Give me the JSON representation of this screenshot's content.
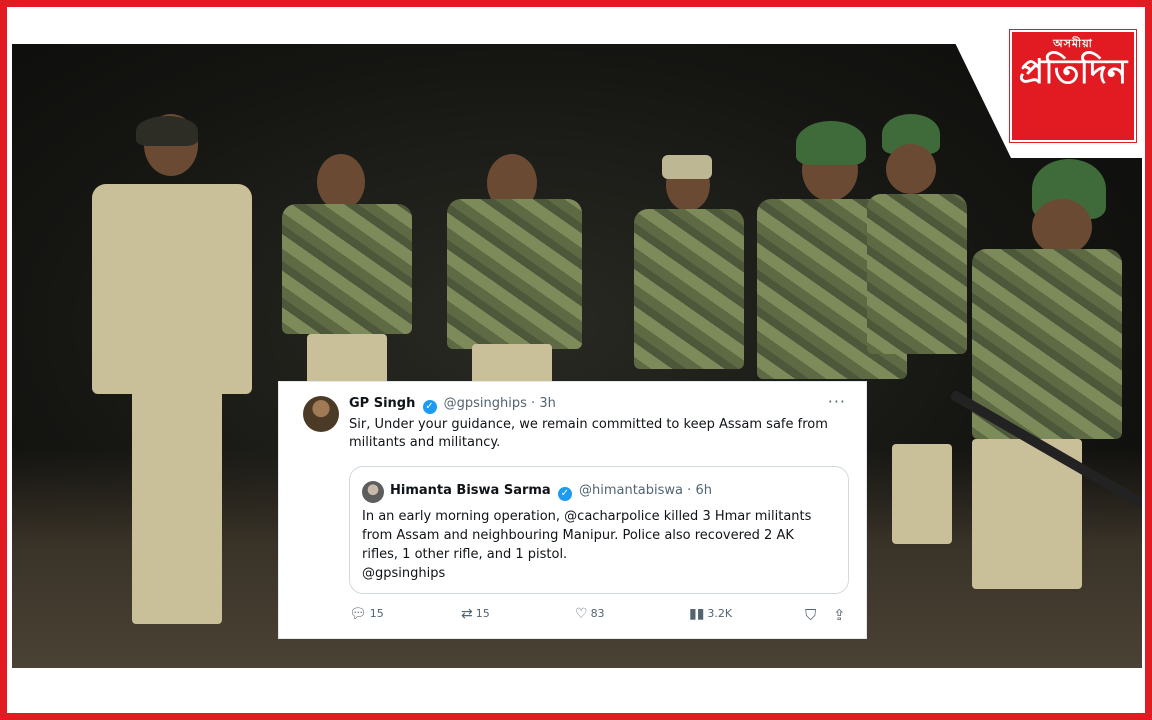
{
  "brand": {
    "logo_small": "অসমীয়া",
    "logo_main": "প্রতিদিন",
    "color": "#e21b22"
  },
  "tweet": {
    "author_name": "GP Singh",
    "author_handle": "@gpsinghips",
    "separator": "·",
    "time": "3h",
    "more_icon": "···",
    "text": "Sir, Under your guidance, we remain committed to keep Assam safe from militants and militancy.",
    "quoted": {
      "author_name": "Himanta Biswa Sarma",
      "author_handle": "@himantabiswa",
      "separator": "·",
      "time": "6h",
      "text": "In an early morning operation, @cacharpolice killed 3 Hmar militants from Assam and neighbouring Manipur. Police also recovered 2 AK rifles, 1 other rifle, and 1 pistol.",
      "mention": "@gpsinghips"
    },
    "actions": {
      "replies": "15",
      "retweets": "15",
      "likes": "83",
      "views": "3.2K"
    },
    "verified_color": "#1d9bf0"
  }
}
